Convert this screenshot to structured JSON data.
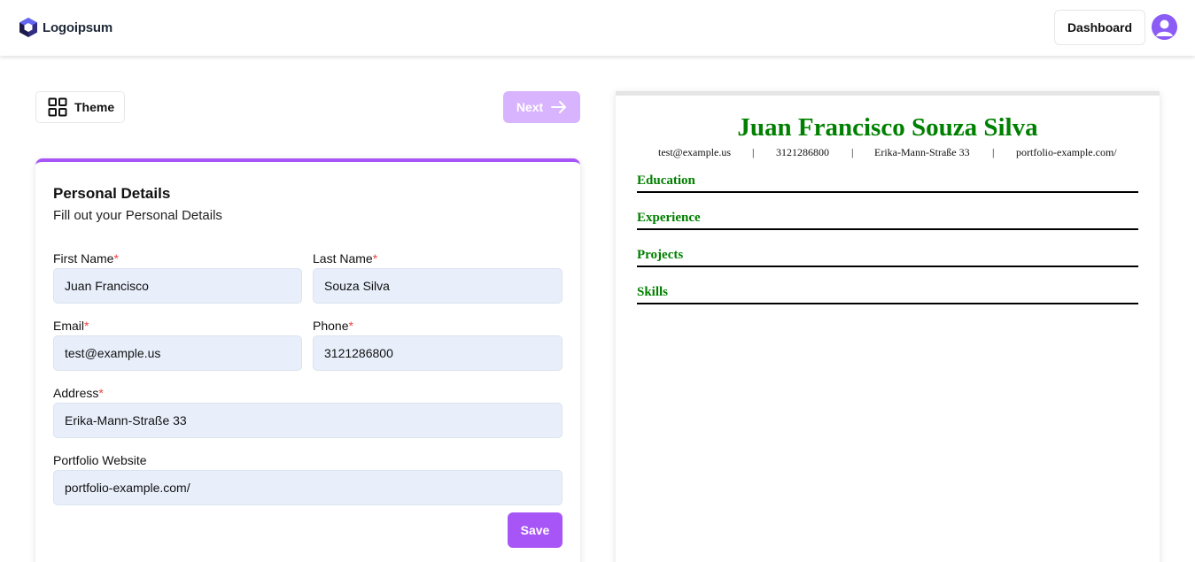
{
  "header": {
    "logo_text": "Logoipsum",
    "dashboard_label": "Dashboard",
    "accent_color": "#8b5cf6"
  },
  "toolbar": {
    "theme_label": "Theme",
    "next_label": "Next"
  },
  "form": {
    "title": "Personal Details",
    "subtitle": "Fill out your Personal Details",
    "first_name": {
      "label": "First Name",
      "required": "*",
      "value": "Juan Francisco"
    },
    "last_name": {
      "label": "Last Name",
      "required": "*",
      "value": "Souza Silva"
    },
    "email": {
      "label": "Email",
      "required": "*",
      "value": "test@example.us"
    },
    "phone": {
      "label": "Phone",
      "required": "*",
      "value": "3121286800"
    },
    "address": {
      "label": "Address",
      "required": "*",
      "value": "Erika-Mann-Straße 33"
    },
    "portfolio": {
      "label": "Portfolio Website",
      "value": "portfolio-example.com/"
    },
    "save_label": "Save",
    "accent_color": "#a855f7"
  },
  "preview": {
    "name": "Juan Francisco Souza Silva",
    "name_color": "#008000",
    "email": "test@example.us",
    "phone": "3121286800",
    "address": "Erika-Mann-Straße 33",
    "portfolio": "portfolio-example.com/",
    "separator": "|",
    "sections": [
      "Education",
      "Experience",
      "Projects",
      "Skills"
    ]
  }
}
